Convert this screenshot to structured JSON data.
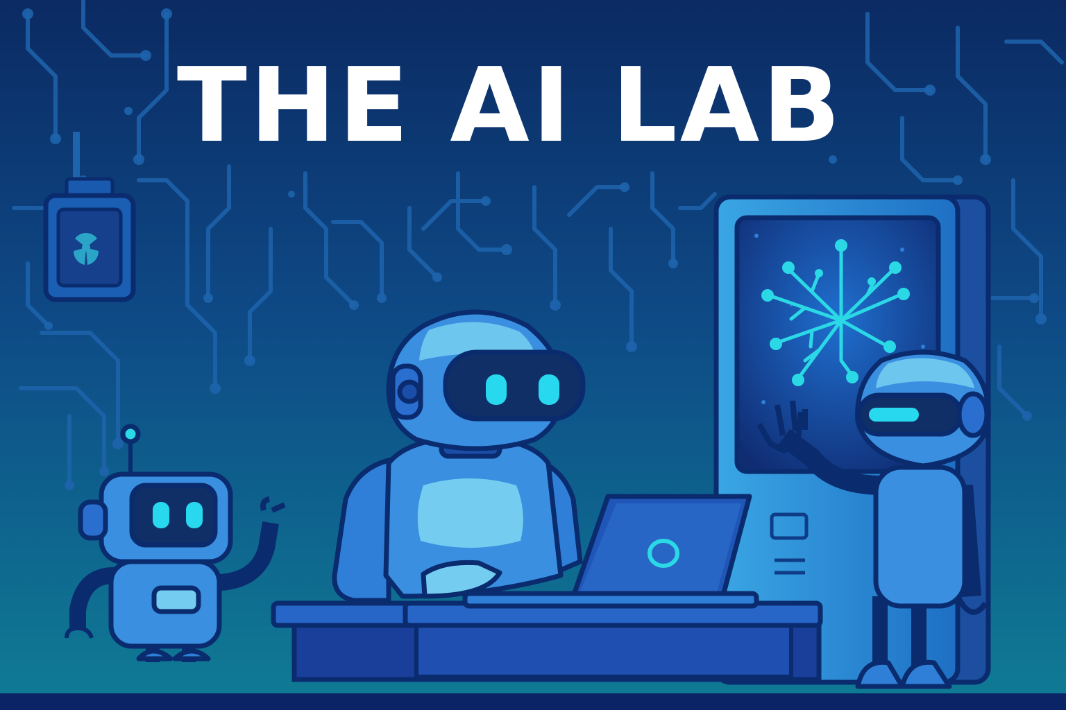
{
  "title": "THE AI LAB",
  "colors": {
    "background_top": "#0b2a63",
    "background_mid": "#0e4a86",
    "background_bottom": "#0f7c95",
    "circuit": "#1e64ad",
    "outline": "#0a2b6e",
    "robot_body": "#3a8fe0",
    "robot_light": "#6cc6ee",
    "visor": "#0f2f66",
    "eye_glow": "#27d8ee",
    "title_text": "#ffffff"
  },
  "icons": {
    "wall_panel": "radiation-icon",
    "screen": "network-graph-icon",
    "laptop": "circle-logo-icon"
  }
}
